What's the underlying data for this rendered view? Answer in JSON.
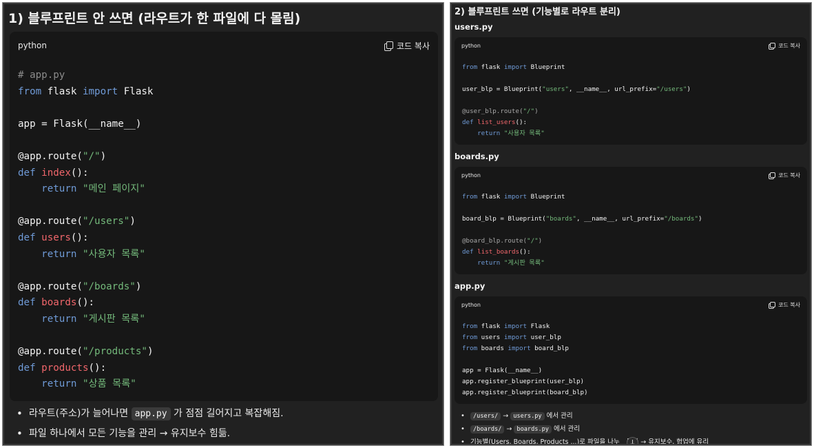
{
  "left": {
    "title": "1) 블루프린트 안 쓰면 (라우트가 한 파일에 다 몰림)",
    "code_lang": "python",
    "copy_label": "코드 복사",
    "code_lines": [
      [
        [
          "c",
          "# app.py"
        ]
      ],
      [
        [
          "k",
          "from"
        ],
        [
          "p",
          " flask "
        ],
        [
          "k",
          "import"
        ],
        [
          "p",
          " Flask"
        ]
      ],
      [],
      [
        [
          "p",
          "app = Flask(__name__)"
        ]
      ],
      [],
      [
        [
          "p",
          "@app.route("
        ],
        [
          "s",
          "\"/\""
        ],
        [
          "p",
          ")"
        ]
      ],
      [
        [
          "k",
          "def"
        ],
        [
          "p",
          " "
        ],
        [
          "f",
          "index"
        ],
        [
          "p",
          "():"
        ]
      ],
      [
        [
          "p",
          "    "
        ],
        [
          "k",
          "return"
        ],
        [
          "p",
          " "
        ],
        [
          "s",
          "\"메인 페이지\""
        ]
      ],
      [],
      [
        [
          "p",
          "@app.route("
        ],
        [
          "s",
          "\"/users\""
        ],
        [
          "p",
          ")"
        ]
      ],
      [
        [
          "k",
          "def"
        ],
        [
          "p",
          " "
        ],
        [
          "f",
          "users"
        ],
        [
          "p",
          "():"
        ]
      ],
      [
        [
          "p",
          "    "
        ],
        [
          "k",
          "return"
        ],
        [
          "p",
          " "
        ],
        [
          "s",
          "\"사용자 목록\""
        ]
      ],
      [],
      [
        [
          "p",
          "@app.route("
        ],
        [
          "s",
          "\"/boards\""
        ],
        [
          "p",
          ")"
        ]
      ],
      [
        [
          "k",
          "def"
        ],
        [
          "p",
          " "
        ],
        [
          "f",
          "boards"
        ],
        [
          "p",
          "():"
        ]
      ],
      [
        [
          "p",
          "    "
        ],
        [
          "k",
          "return"
        ],
        [
          "p",
          " "
        ],
        [
          "s",
          "\"게시판 목록\""
        ]
      ],
      [],
      [
        [
          "p",
          "@app.route("
        ],
        [
          "s",
          "\"/products\""
        ],
        [
          "p",
          ")"
        ]
      ],
      [
        [
          "k",
          "def"
        ],
        [
          "p",
          " "
        ],
        [
          "f",
          "products"
        ],
        [
          "p",
          "():"
        ]
      ],
      [
        [
          "p",
          "    "
        ],
        [
          "k",
          "return"
        ],
        [
          "p",
          " "
        ],
        [
          "s",
          "\"상품 목록\""
        ]
      ]
    ],
    "bullets": [
      [
        [
          "t",
          "라우트(주소)가 늘어나면 "
        ],
        [
          "code",
          "app.py"
        ],
        [
          "t",
          " 가 점점 길어지고 복잡해짐."
        ]
      ],
      [
        [
          "t",
          "파일 하나에서 모든 기능을 관리 → 유지보수 힘듦."
        ]
      ]
    ]
  },
  "right": {
    "title": "2) 블루프린트 쓰면 (기능별로 라우트 분리)",
    "blocks": [
      {
        "file": "users.py",
        "lang": "python",
        "copy_label": "코드 복사",
        "lines": [
          [
            [
              "k",
              "from"
            ],
            [
              "p",
              " flask "
            ],
            [
              "k",
              "import"
            ],
            [
              "p",
              " Blueprint"
            ]
          ],
          [],
          [
            [
              "p",
              "user_blp = Blueprint("
            ],
            [
              "s",
              "\"users\""
            ],
            [
              "p",
              ", __name__, url_prefix="
            ],
            [
              "s",
              "\"/users\""
            ],
            [
              "p",
              ")"
            ]
          ],
          [],
          [
            [
              "d",
              "@user_blp.route("
            ],
            [
              "s",
              "\"/\""
            ],
            [
              "d",
              ")"
            ]
          ],
          [
            [
              "k",
              "def"
            ],
            [
              "p",
              " "
            ],
            [
              "f",
              "list_users"
            ],
            [
              "p",
              "():"
            ]
          ],
          [
            [
              "p",
              "    "
            ],
            [
              "k",
              "return"
            ],
            [
              "p",
              " "
            ],
            [
              "s",
              "\"사용자 목록\""
            ]
          ]
        ]
      },
      {
        "file": "boards.py",
        "lang": "python",
        "copy_label": "코드 복사",
        "lines": [
          [
            [
              "k",
              "from"
            ],
            [
              "p",
              " flask "
            ],
            [
              "k",
              "import"
            ],
            [
              "p",
              " Blueprint"
            ]
          ],
          [],
          [
            [
              "p",
              "board_blp = Blueprint("
            ],
            [
              "s",
              "\"boards\""
            ],
            [
              "p",
              ", __name__, url_prefix="
            ],
            [
              "s",
              "\"/boards\""
            ],
            [
              "p",
              ")"
            ]
          ],
          [],
          [
            [
              "d",
              "@board_blp.route("
            ],
            [
              "s",
              "\"/\""
            ],
            [
              "d",
              ")"
            ]
          ],
          [
            [
              "k",
              "def"
            ],
            [
              "p",
              " "
            ],
            [
              "f",
              "list_boards"
            ],
            [
              "p",
              "():"
            ]
          ],
          [
            [
              "p",
              "    "
            ],
            [
              "k",
              "return"
            ],
            [
              "p",
              " "
            ],
            [
              "s",
              "\"게시판 목록\""
            ]
          ]
        ]
      },
      {
        "file": "app.py",
        "lang": "python",
        "copy_label": "코드 복사",
        "lines": [
          [
            [
              "k",
              "from"
            ],
            [
              "p",
              " flask "
            ],
            [
              "k",
              "import"
            ],
            [
              "p",
              " Flask"
            ]
          ],
          [
            [
              "k",
              "from"
            ],
            [
              "p",
              " users "
            ],
            [
              "k",
              "import"
            ],
            [
              "p",
              " user_blp"
            ]
          ],
          [
            [
              "k",
              "from"
            ],
            [
              "p",
              " boards "
            ],
            [
              "k",
              "import"
            ],
            [
              "p",
              " board_blp"
            ]
          ],
          [],
          [
            [
              "p",
              "app = Flask(__name__)"
            ]
          ],
          [
            [
              "p",
              "app.register_blueprint(user_blp)"
            ]
          ],
          [
            [
              "p",
              "app.register_blueprint(board_blp)"
            ]
          ]
        ]
      }
    ],
    "bullets": [
      [
        [
          "code",
          "/users/"
        ],
        [
          "t",
          " → "
        ],
        [
          "code",
          "users.py"
        ],
        [
          "t",
          " 에서 관리"
        ]
      ],
      [
        [
          "code",
          "/boards/"
        ],
        [
          "t",
          " → "
        ],
        [
          "code",
          "boards.py"
        ],
        [
          "t",
          " 에서 관리"
        ]
      ],
      [
        [
          "t",
          "기능별(Users, Boards, Products ...)로 파일을 나누"
        ],
        [
          "gap",
          ""
        ],
        [
          "t",
          "듈화 → 유지보수, 협업에 유리"
        ]
      ]
    ],
    "scroll_icon": "arrow-down-icon",
    "scroll_glyph": "↓"
  }
}
